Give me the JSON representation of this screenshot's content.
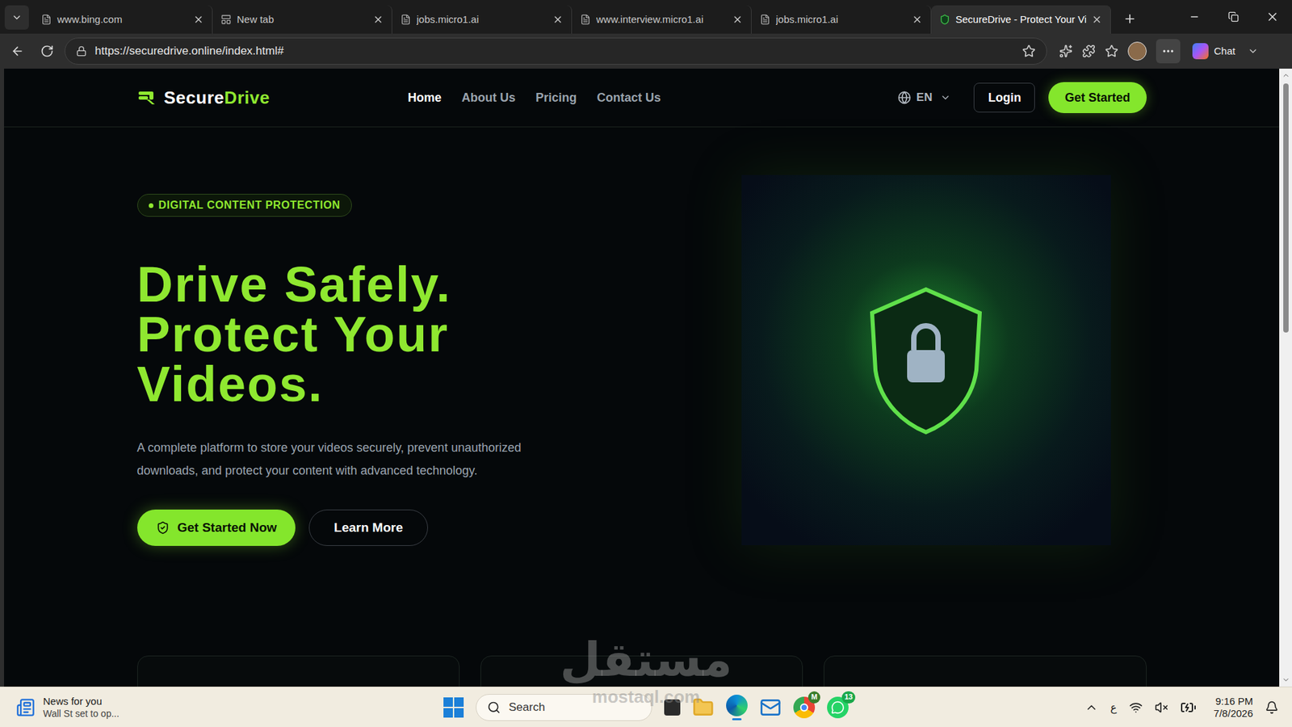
{
  "browser": {
    "tabs": [
      {
        "label": "www.bing.com",
        "selected": false,
        "kind": "page"
      },
      {
        "label": "New tab",
        "selected": false,
        "kind": "newtab"
      },
      {
        "label": "jobs.micro1.ai",
        "selected": false,
        "kind": "page"
      },
      {
        "label": "www.interview.micro1.ai",
        "selected": false,
        "kind": "page"
      },
      {
        "label": "jobs.micro1.ai",
        "selected": false,
        "kind": "page"
      },
      {
        "label": "SecureDrive - Protect Your Vi",
        "selected": true,
        "kind": "site"
      }
    ],
    "address": "https://securedrive.online/index.html#",
    "chat": "Chat"
  },
  "site": {
    "logo": {
      "first": "Secure",
      "second": "Drive"
    },
    "nav": [
      {
        "label": "Home",
        "selected": true
      },
      {
        "label": "About Us",
        "selected": false
      },
      {
        "label": "Pricing",
        "selected": false
      },
      {
        "label": "Contact Us",
        "selected": false
      }
    ],
    "language": "EN",
    "login": "Login",
    "cta": "Get Started",
    "badge": "DIGITAL CONTENT PROTECTION",
    "headline": [
      "Drive Safely.",
      "Protect Your",
      "Videos."
    ],
    "description": [
      "A complete platform to store your videos securely, prevent unauthorized",
      "downloads, and protect your content with advanced technology."
    ],
    "primary_button": "Get Started Now",
    "secondary_button": "Learn More",
    "cards": 3
  },
  "watermark": {
    "arabic": "مستقل",
    "latin": "mostaql.com"
  },
  "taskbar": {
    "news": {
      "title": "News for you",
      "subtitle": "Wall St set to op..."
    },
    "search": "Search",
    "chrome_badge": "M",
    "whatsapp_badge": "13",
    "language": "ع",
    "time": "9:16 PM",
    "date": "7/8/2026"
  }
}
